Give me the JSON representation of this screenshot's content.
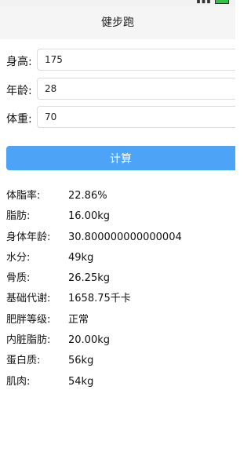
{
  "nav": {
    "title": "健步跑"
  },
  "form": {
    "height": {
      "label": "身高:",
      "value": "175"
    },
    "age": {
      "label": "年龄:",
      "value": "28"
    },
    "weight": {
      "label": "体重:",
      "value": "70"
    }
  },
  "calc_button_label": "计算",
  "results": [
    {
      "label": "体脂率:",
      "value": "22.86%"
    },
    {
      "label": "脂肪:",
      "value": "16.00kg"
    },
    {
      "label": "身体年龄:",
      "value": "30.800000000000004"
    },
    {
      "label": "水分:",
      "value": "49kg"
    },
    {
      "label": "骨质:",
      "value": "26.25kg"
    },
    {
      "label": "基础代谢:",
      "value": "1658.75千卡"
    },
    {
      "label": "肥胖等级:",
      "value": "正常"
    },
    {
      "label": "内脏脂肪:",
      "value": "20.00kg"
    },
    {
      "label": "蛋白质:",
      "value": "56kg"
    },
    {
      "label": "肌肉:",
      "value": "54kg"
    }
  ]
}
